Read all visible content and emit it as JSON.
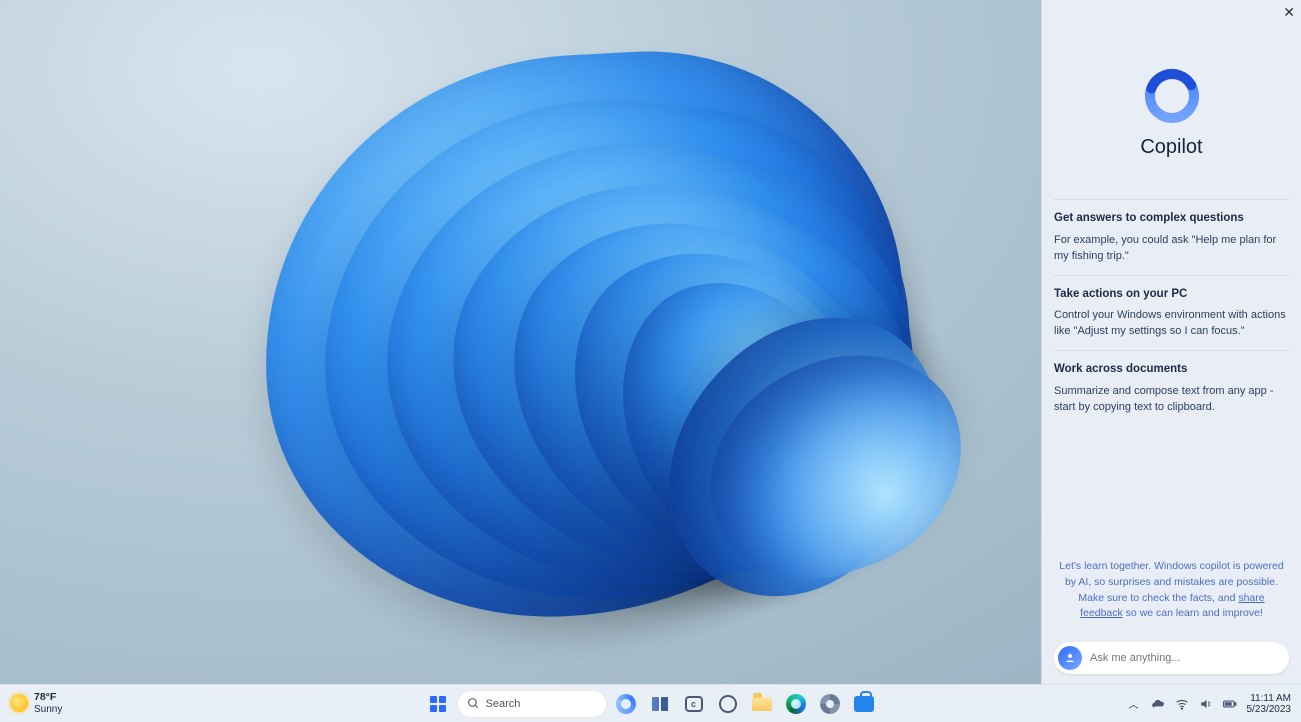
{
  "copilot": {
    "title": "Copilot",
    "close_icon": "close-icon",
    "sections": [
      {
        "heading": "Get answers to complex questions",
        "body": "For example, you could ask \"Help me plan for my fishing trip.\""
      },
      {
        "heading": "Take actions on your PC",
        "body": "Control your Windows environment with actions like \"Adjust my settings so I can focus.\""
      },
      {
        "heading": "Work across documents",
        "body": "Summarize and compose text from any app - start by copying text to clipboard."
      }
    ],
    "disclaimer_pre": "Let's learn together. Windows copilot is powered by AI, so surprises and mistakes are possible. Make sure to check the facts, and ",
    "disclaimer_link": "share feedback",
    "disclaimer_post": " so we can learn and improve!",
    "input_placeholder": "Ask me anything..."
  },
  "taskbar": {
    "weather": {
      "temp": "78°F",
      "condition": "Sunny"
    },
    "search_placeholder": "Search",
    "icons": {
      "start": "start-icon",
      "search": "search-icon",
      "copilot": "copilot-icon",
      "task_view": "task-view-icon",
      "chat": "chat-icon",
      "explorer": "file-explorer-icon",
      "edge": "edge-icon",
      "store": "store-icon",
      "settings": "settings-icon"
    },
    "tray": {
      "overflow": "chevron-up-icon",
      "onedrive": "cloud-icon",
      "wifi": "wifi-icon",
      "volume": "volume-icon",
      "battery": "battery-icon",
      "time": "11:11 AM",
      "date": "5/23/2023"
    }
  }
}
